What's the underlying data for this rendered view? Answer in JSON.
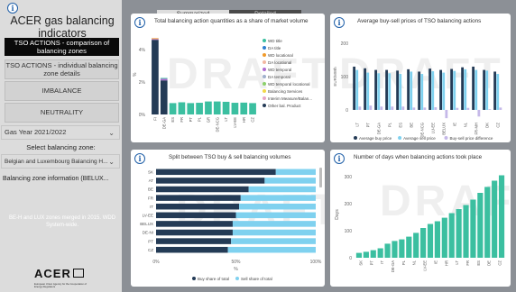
{
  "sidebar": {
    "info_glyph": "i",
    "title": "ACER gas balancing indicators",
    "nav": [
      {
        "label": "TSO ACTIONS - comparison of balancing zones",
        "active": true
      },
      {
        "label": "TSO ACTIONS - individual balancing zone details",
        "active": false
      },
      {
        "label": "IMBALANCE",
        "active": false
      },
      {
        "label": "NEUTRALITY",
        "active": false
      }
    ],
    "gas_year": "Gas Year 2021/2022",
    "zone_prompt": "Select balancing zone:",
    "zone_value": "Belgian and Luxembourg Balancing H...",
    "zone_info": "Balancing zone information (BELUX...",
    "note": "BE-H and LUX zones merged in 2015. WDD System-wide.",
    "logo_word": "ACER",
    "logo_sub": "European Union Agency for the Cooperation of Energy Regulators"
  },
  "tabs": {
    "summarized": "Summarized",
    "detailed": "Detailed"
  },
  "watermark": "DRAFT",
  "colors": {
    "teal": "#3bbfa0",
    "navy": "#243b56",
    "lightblue": "#7fd1ef",
    "blue": "#2b93d6",
    "lavender": "#c5b8e8"
  },
  "chart_data": [
    {
      "type": "bar",
      "title": "Total balancing action quantities as a share of market volume",
      "ylabel": "%",
      "yticks": [
        "4%",
        "2%",
        "0%"
      ],
      "ylim": [
        0,
        5
      ],
      "categories": [
        "FI",
        "DE-GA",
        "ES",
        "FR",
        "PT",
        "PL",
        "GR",
        "DE-NCG",
        "LT",
        "LV-EE",
        "HR",
        "CZ"
      ],
      "stacked_values": [
        {
          "Other bal. Product": 4.6,
          "WD temporal": 0.05,
          "WD locational": 0.05
        },
        {
          "Other bal. Product": 2.1,
          "WD temporal": 0.1,
          "WD title": 0.05
        },
        {
          "WD title": 0.7
        },
        {
          "WD title": 0.75
        },
        {
          "WD title": 0.7
        },
        {
          "WD title": 0.72
        },
        {
          "WD title": 0.8
        },
        {
          "WD title": 0.8
        },
        {
          "WD title": 0.78
        },
        {
          "WD title": 0.72
        },
        {
          "WD title": 0.73
        },
        {
          "WD title": 0.7
        }
      ],
      "legend": [
        {
          "name": "WD title",
          "color": "#3bbfa0"
        },
        {
          "name": "DA title",
          "color": "#2f7fd1"
        },
        {
          "name": "WD locational",
          "color": "#f09a2b"
        },
        {
          "name": "DA locational",
          "color": "#f2b8a2"
        },
        {
          "name": "WD temporal",
          "color": "#b06cd1"
        },
        {
          "name": "DA temporal",
          "color": "#a0b0cc"
        },
        {
          "name": "WD temporal locational",
          "color": "#8bd06a"
        },
        {
          "name": "Balancing Services",
          "color": "#f2d84a"
        },
        {
          "name": "Interim Measure/Balan...",
          "color": "#e6a6c8"
        },
        {
          "name": "Other bal. Product",
          "color": "#243b56"
        }
      ]
    },
    {
      "type": "bar",
      "title": "Average buy-sell prices of TSO balancing actions",
      "ylabel": "EUR/MWh",
      "yticks": [
        "200",
        "100",
        "0"
      ],
      "ylim": [
        -30,
        230
      ],
      "categories": [
        "LT",
        "PT",
        "DE-GA",
        "PL",
        "ES",
        "BE",
        "DE-NCG",
        "LU-EE",
        "BELUX",
        "IE",
        "NL",
        "FR-MH",
        "DK",
        "CZ"
      ],
      "series": [
        {
          "name": "Average buy price",
          "values": [
            130,
            125,
            120,
            120,
            118,
            122,
            115,
            124,
            120,
            123,
            128,
            130,
            120,
            115
          ]
        },
        {
          "name": "Average sell price",
          "values": [
            120,
            112,
            110,
            110,
            108,
            115,
            108,
            116,
            112,
            117,
            122,
            120,
            118,
            108
          ]
        },
        {
          "name": "Buy-sell price difference",
          "values": [
            10,
            13,
            10,
            10,
            10,
            7,
            7,
            8,
            -25,
            6,
            6,
            -20,
            2,
            7
          ]
        }
      ]
    },
    {
      "type": "bar",
      "title": "Split between TSO buy & sell balancing volumes",
      "xlabel": "%",
      "xticks": [
        "0%",
        "50%",
        "100%"
      ],
      "categories": [
        "SK",
        "AT",
        "BE",
        "FR",
        "IT",
        "LV-EE",
        "BELUX",
        "DE-NI",
        "PT",
        "CZ"
      ],
      "series": [
        {
          "name": "Buy share of total",
          "values": [
            75,
            68,
            58,
            53,
            52,
            50,
            48,
            48,
            47,
            45
          ]
        },
        {
          "name": "Sell share of total",
          "values": [
            25,
            32,
            42,
            47,
            48,
            50,
            52,
            52,
            53,
            55
          ]
        }
      ]
    },
    {
      "type": "bar",
      "title": "Number of days when balancing actions took place",
      "ylabel": "Days",
      "yticks": [
        "300",
        "200",
        "100",
        "0"
      ],
      "ylim": [
        0,
        320
      ],
      "categories": [
        "SK",
        "PT",
        "IT",
        "DE-GA",
        "PL",
        "NL",
        "LV-EE",
        "IE",
        "HR",
        "LT",
        "FR",
        "ES",
        "DE",
        "CZ"
      ],
      "values": [
        18,
        22,
        28,
        35,
        52,
        62,
        68,
        78,
        92,
        110,
        125,
        135,
        148,
        165,
        180,
        195,
        215,
        240,
        262,
        285,
        305
      ]
    }
  ]
}
